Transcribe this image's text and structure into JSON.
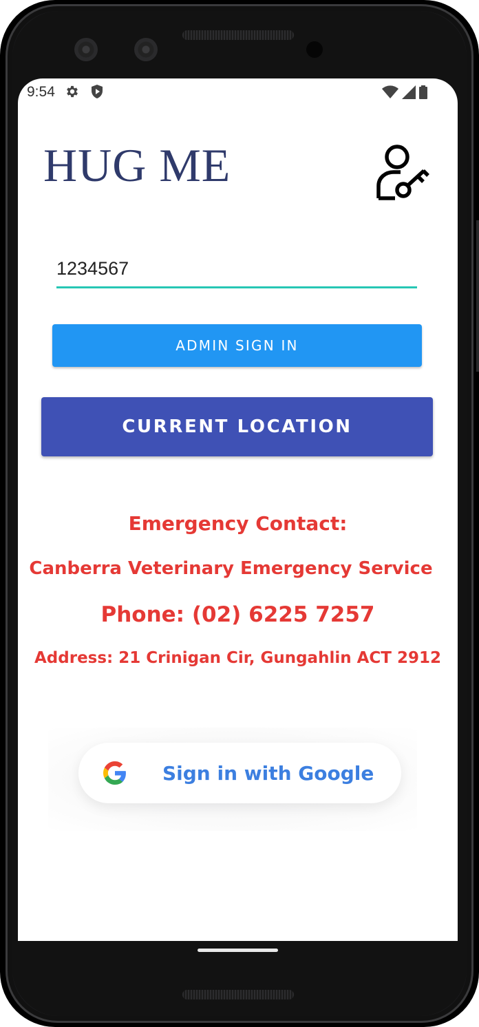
{
  "status_bar": {
    "time": "9:54",
    "left_icons": [
      "settings-gear-icon",
      "shield-icon"
    ],
    "right_icons": [
      "wifi-icon",
      "cell-signal-icon",
      "battery-icon"
    ]
  },
  "header": {
    "title": "HUG ME",
    "title_color": "#2f3a6b",
    "admin_icon": "user-key-icon"
  },
  "form": {
    "admin_code_value": "1234567",
    "underline_color": "#26c6b4"
  },
  "buttons": {
    "admin_sign_in": "ADMIN SIGN IN",
    "admin_sign_in_color": "#2196f3",
    "current_location": "CURRENT LOCATION",
    "current_location_color": "#3f51b5"
  },
  "emergency": {
    "heading": "Emergency Contact:",
    "name": "Canberra Veterinary Emergency Service",
    "phone": "Phone: (02) 6225 7257",
    "address": "Address: 21 Crinigan Cir, Gungahlin ACT 2912",
    "text_color": "#e53935"
  },
  "google": {
    "label": "Sign in with Google",
    "icon": "google-g-icon",
    "label_color": "#3c7fe0"
  }
}
